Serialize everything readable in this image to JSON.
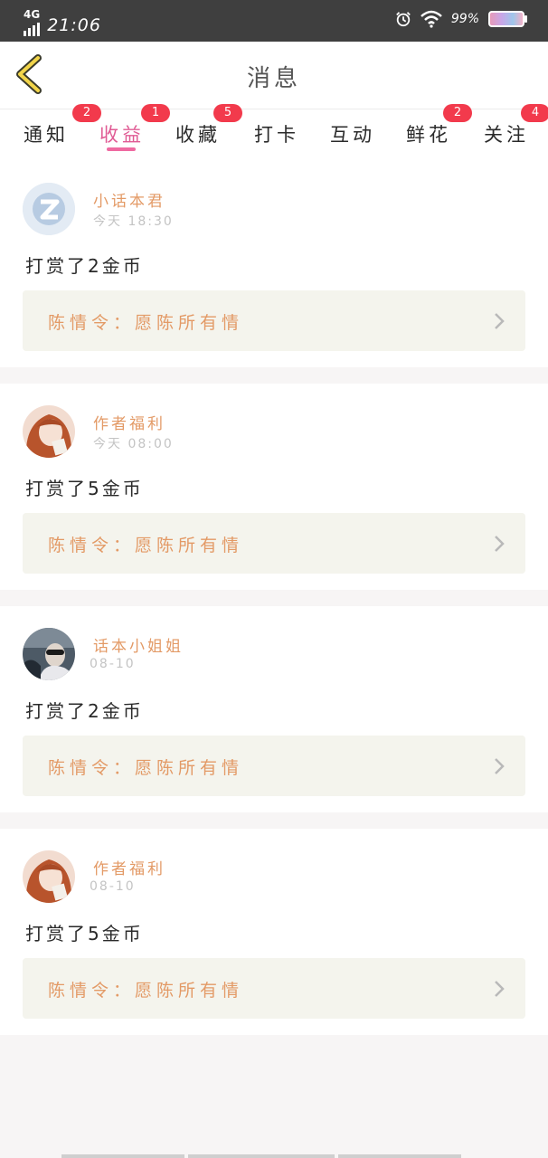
{
  "status_bar": {
    "network": "4G",
    "time": "21:06",
    "battery": "99%"
  },
  "header": {
    "title": "消息"
  },
  "tabs": [
    {
      "label": "通知",
      "badge": "2"
    },
    {
      "label": "收益",
      "badge": "1"
    },
    {
      "label": "收藏",
      "badge": "5"
    },
    {
      "label": "打卡",
      "badge": ""
    },
    {
      "label": "互动",
      "badge": ""
    },
    {
      "label": "鲜花",
      "badge": "2"
    },
    {
      "label": "关注",
      "badge": "4"
    }
  ],
  "active_tab": "收益",
  "feed": [
    {
      "name": "小话本君",
      "time": "今天 18:30",
      "text": "打赏了2金币",
      "link": "陈情令：愿陈所有情",
      "avatar": "logo-avatar"
    },
    {
      "name": "作者福利",
      "time": "今天 08:00",
      "text": "打赏了5金币",
      "link": "陈情令：愿陈所有情",
      "avatar": "anime-girl-avatar"
    },
    {
      "name": "话本小姐姐",
      "time": "08-10",
      "text": "打赏了2金币",
      "link": "陈情令：愿陈所有情",
      "avatar": "photo-avatar"
    },
    {
      "name": "作者福利",
      "time": "08-10",
      "text": "打赏了5金币",
      "link": "陈情令：愿陈所有情",
      "avatar": "anime-girl-avatar"
    }
  ],
  "colors": {
    "accent": "#e05b94",
    "name": "#e39a66",
    "badge": "#f23a4c",
    "link_bg": "#f4f4ed"
  }
}
